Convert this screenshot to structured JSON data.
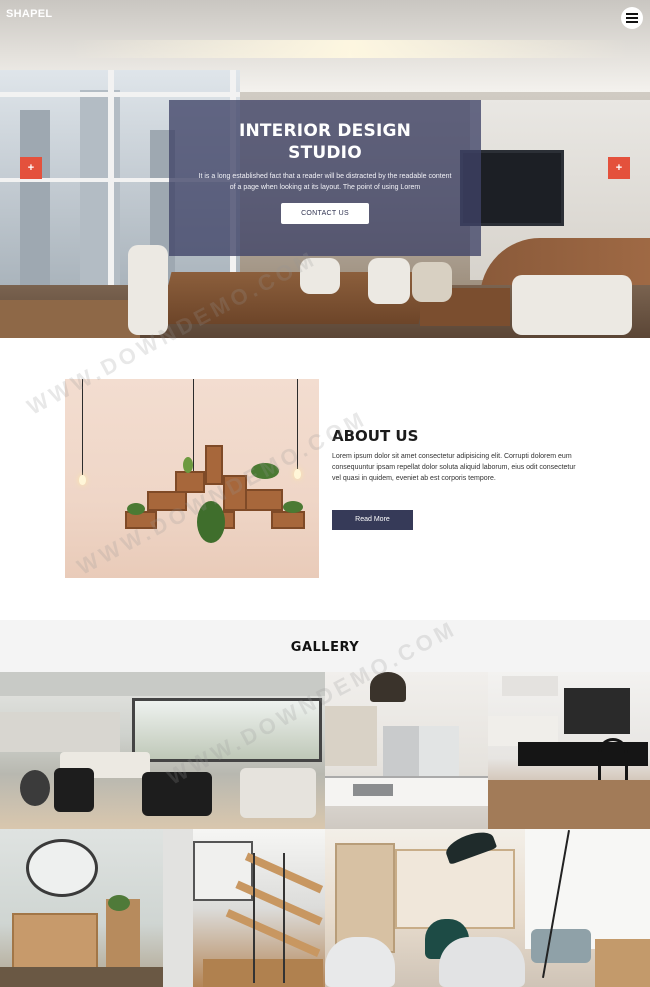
{
  "header": {
    "brand": "SHAPEL",
    "menu_icon": "hamburger-menu-icon"
  },
  "hero": {
    "title_line1": "INTERIOR DESIGN",
    "title_line2": "STUDIO",
    "text": "It is a long established fact that a reader will be distracted by the readable content of a page when looking at its layout. The point of using Lorem",
    "button_label": "CONTACT US",
    "prev_arrow": "+",
    "next_arrow": "+"
  },
  "about": {
    "title": "ABOUT US",
    "text": "Lorem ipsum dolor sit amet consectetur adipisicing elit. Corrupti dolorem eum consequuntur ipsam repellat dolor soluta aliquid laborum, eius odit consectetur vel quasi in quidem, eveniet ab est corporis tempore.",
    "button_label": "Read More"
  },
  "gallery": {
    "title": "GALLERY"
  },
  "watermark": {
    "line1": "WWW.DOWNDEMO.COM",
    "line2": "WWW.DOWNDEMO.COM",
    "line3": "WWW.DOWNDEMO.COM"
  },
  "colors": {
    "accent_red": "#e4513c",
    "card_overlay": "#3f4266",
    "button_navy": "#363a58"
  }
}
